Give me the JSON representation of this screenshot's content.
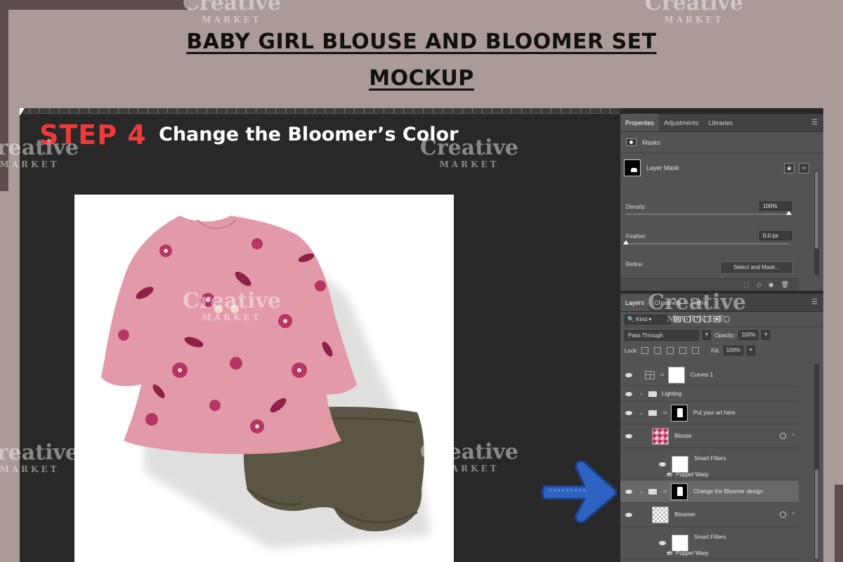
{
  "page": {
    "title_line1": "BABY GIRL BLOUSE AND BLOOMER SET",
    "title_line2": "MOCKUP",
    "step_label": "STEP 4",
    "step_title": "Change the Bloomer’s Color"
  },
  "watermark": {
    "name": "Creative",
    "sub": "MARKET"
  },
  "properties": {
    "tabs": [
      "Properties",
      "Adjustments",
      "Libraries"
    ],
    "masks_label": "Masks",
    "layer_mask_label": "Layer Mask",
    "density_label": "Density:",
    "density_value": "100%",
    "feather_label": "Feather:",
    "feather_value": "0.0 px",
    "refine_label": "Refine:",
    "select_mask_label": "Select and Mask..."
  },
  "layers_panel": {
    "tabs": [
      "Layers",
      "Channels",
      "Paths"
    ],
    "kind_label": "Kind",
    "blend_mode": "Pass Through",
    "opacity_label": "Opacity:",
    "opacity_value": "100%",
    "lock_label": "Lock:",
    "fill_label": "Fill:",
    "fill_value": "100%",
    "layers": [
      {
        "name": "Curves 1"
      },
      {
        "name": "Lighting"
      },
      {
        "name": "Put your art here"
      },
      {
        "name": "Blouse"
      },
      {
        "name": "Smart Filters",
        "sub": "Puppet Warp"
      },
      {
        "name": "Change the Bloomer design"
      },
      {
        "name": "Bloomer"
      },
      {
        "name": "Smart Filters",
        "sub": "Puppet Warp"
      }
    ]
  },
  "colors": {
    "background": "#aa9b99",
    "workspace": "#282828",
    "step_accent": "#ee3a3a",
    "bloomer": "#5b5545",
    "blouse": "#e39aa8",
    "arrow": "#2f63c2"
  }
}
